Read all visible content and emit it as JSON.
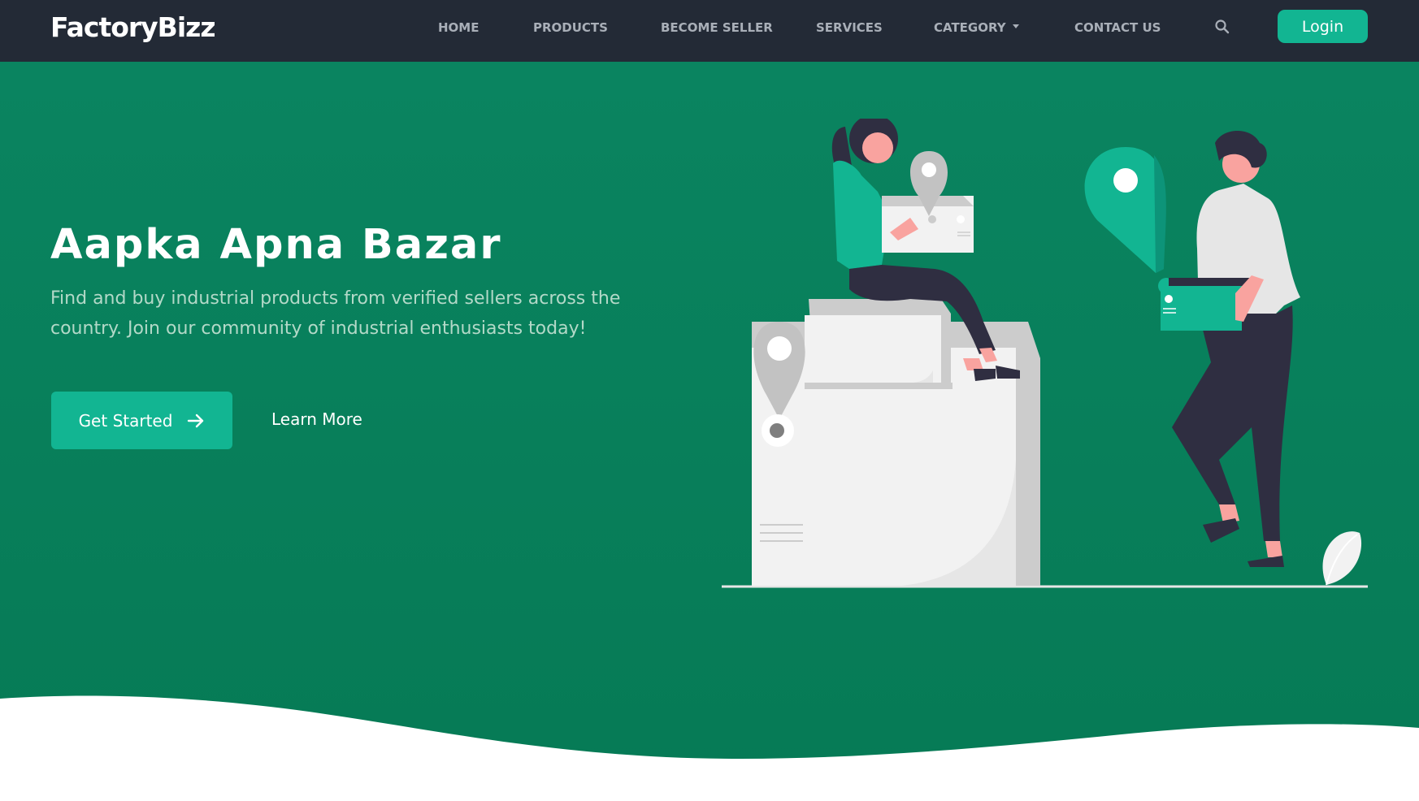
{
  "nav": {
    "brand": "FactoryBizz",
    "links": [
      "HOME",
      "PRODUCTS",
      "BECOME SELLER",
      "SERVICES",
      "CATEGORY",
      "CONTACT US"
    ],
    "login_label": "Login",
    "icons": {
      "search": "search-icon",
      "category": "caret-down-icon"
    }
  },
  "hero": {
    "title": "Aapka Apna Bazar",
    "subtitle": "Find and buy industrial products from verified sellers across the country. Join our community of industrial enthusiasts today!",
    "primary_cta": "Get Started",
    "secondary_cta": "Learn More"
  },
  "colors": {
    "navbar": "#232a36",
    "hero_green": "#087f5b",
    "accent": "#12b592",
    "nav_text": "#a9afb8"
  }
}
